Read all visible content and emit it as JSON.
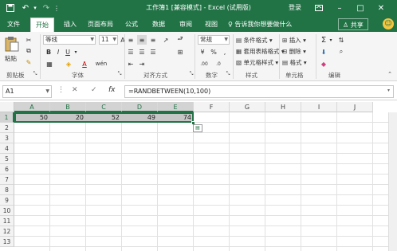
{
  "titlebar": {
    "title": "工作簿1 [兼容模式] - Excel (试用版)",
    "login": "登录",
    "save_icon": "save-icon",
    "undo_icon": "undo-icon",
    "redo_icon": "redo-icon"
  },
  "tabs": [
    {
      "label": "文件"
    },
    {
      "label": "开始"
    },
    {
      "label": "插入"
    },
    {
      "label": "页面布局"
    },
    {
      "label": "公式"
    },
    {
      "label": "数据"
    },
    {
      "label": "审阅"
    },
    {
      "label": "视图"
    }
  ],
  "tell_me": "告诉我你想要做什么",
  "share": "共享",
  "ribbon": {
    "clipboard": {
      "paste": "粘贴",
      "label": "剪贴板"
    },
    "font": {
      "name": "等线",
      "size": "11",
      "label": "字体"
    },
    "alignment": {
      "label": "对齐方式"
    },
    "number": {
      "format": "常规",
      "label": "数字"
    },
    "styles": {
      "conditional": "条件格式",
      "table": "套用表格格式",
      "cell": "单元格样式",
      "label": "样式"
    },
    "cells": {
      "insert": "插入",
      "delete": "删除",
      "format": "格式",
      "label": "单元格"
    },
    "editing": {
      "label": "编辑"
    }
  },
  "formula_bar": {
    "name_box": "A1",
    "formula": "=RANDBETWEEN(10,100)"
  },
  "grid": {
    "columns": [
      "A",
      "B",
      "C",
      "D",
      "E",
      "F",
      "G",
      "H",
      "I",
      "J"
    ],
    "rows": [
      "1",
      "2",
      "3",
      "4",
      "5",
      "6",
      "7",
      "8",
      "9",
      "10",
      "11",
      "12",
      "13"
    ],
    "row1_values": [
      "50",
      "20",
      "52",
      "49",
      "74"
    ]
  },
  "colors": {
    "accent": "#217346"
  }
}
